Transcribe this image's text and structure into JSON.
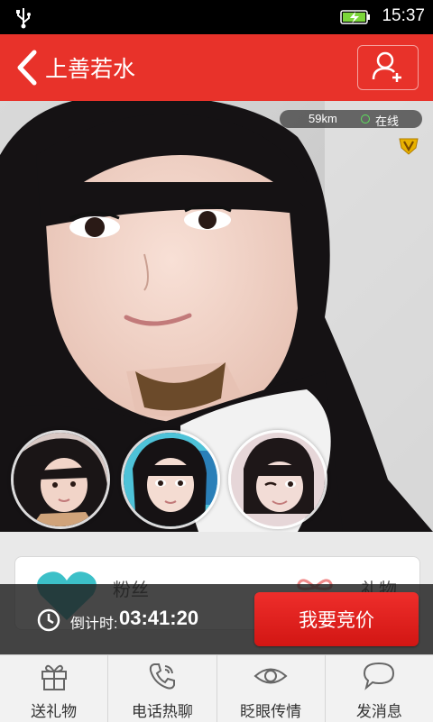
{
  "status_bar": {
    "time": "15:37",
    "icons": [
      "usb-icon",
      "battery-charging-icon"
    ]
  },
  "header": {
    "title": "上善若水",
    "back_icon": "chevron-left-icon",
    "add_icon": "add-friend-icon",
    "color": "#e8322a"
  },
  "profile": {
    "distance": "59km",
    "online": "在线",
    "online_color": "#5ee25e",
    "vip_icon": "vip-badge-icon",
    "thumbnails": [
      "photo-1",
      "photo-2",
      "photo-3"
    ]
  },
  "stats": {
    "fans_label": "粉丝",
    "gifts_label": "礼物"
  },
  "auction": {
    "countdown_label": "倒计时:",
    "countdown": "03:41:20",
    "bid_button": "我要竞价",
    "accent": "#e02420"
  },
  "tabs": [
    {
      "label": "送礼物",
      "icon": "gift-icon"
    },
    {
      "label": "电话热聊",
      "icon": "phone-icon"
    },
    {
      "label": "眨眼传情",
      "icon": "eye-icon"
    },
    {
      "label": "发消息",
      "icon": "message-bubble-icon"
    }
  ]
}
